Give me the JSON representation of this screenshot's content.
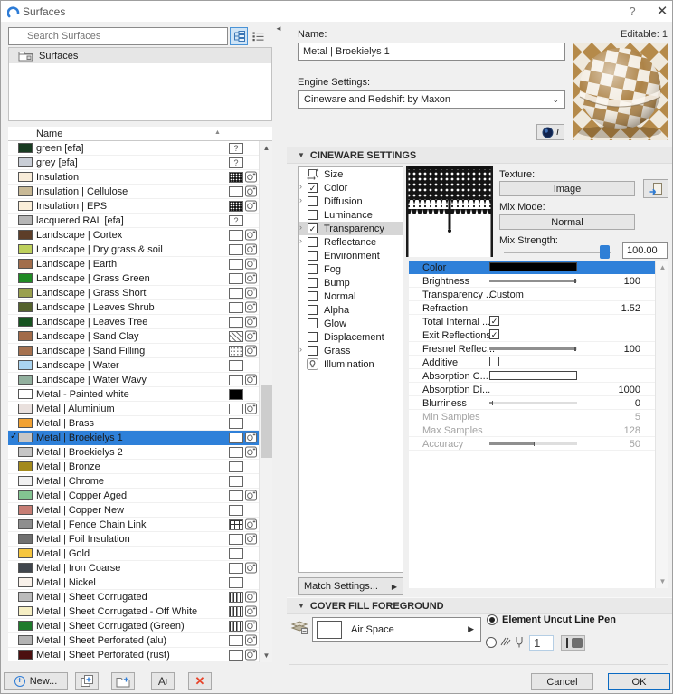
{
  "titlebar": {
    "title": "Surfaces",
    "help": "?",
    "close": "✕"
  },
  "left": {
    "search_placeholder": "Search Surfaces",
    "root_folder": "Surfaces",
    "list_header": "Name",
    "rows": [
      {
        "name": "green [efa]",
        "swatch": "#173a20",
        "fill": "question",
        "camera": false
      },
      {
        "name": "grey [efa]",
        "swatch": "#c9ced6",
        "fill": "question",
        "camera": false
      },
      {
        "name": "Insulation",
        "swatch": "#f8ecd9",
        "fill": "hatch_dense",
        "camera": true
      },
      {
        "name": "Insulation | Cellulose",
        "swatch": "#c8b996",
        "fill": "plain",
        "camera": true
      },
      {
        "name": "Insulation | EPS",
        "swatch": "#faeed9",
        "fill": "hatch_dense",
        "camera": true
      },
      {
        "name": "lacquered RAL [efa]",
        "swatch": "#b5b5b5",
        "fill": "question",
        "camera": false
      },
      {
        "name": "Landscape | Cortex",
        "swatch": "#5d3e29",
        "fill": "plain",
        "camera": true
      },
      {
        "name": "Landscape | Dry grass & soil",
        "swatch": "#bdd05c",
        "fill": "plain",
        "camera": true
      },
      {
        "name": "Landscape | Earth",
        "swatch": "#a26e4c",
        "fill": "plain",
        "camera": true
      },
      {
        "name": "Landscape | Grass Green",
        "swatch": "#1f8a24",
        "fill": "plain",
        "camera": true
      },
      {
        "name": "Landscape | Grass Short",
        "swatch": "#9aa04e",
        "fill": "plain",
        "camera": true
      },
      {
        "name": "Landscape | Leaves Shrub",
        "swatch": "#55632e",
        "fill": "plain",
        "camera": true
      },
      {
        "name": "Landscape | Leaves Tree",
        "swatch": "#175320",
        "fill": "plain",
        "camera": true
      },
      {
        "name": "Landscape | Sand Clay",
        "swatch": "#a26b49",
        "fill": "hatch_diag",
        "camera": true
      },
      {
        "name": "Landscape | Sand Filling",
        "swatch": "#a5714f",
        "fill": "dots",
        "camera": true
      },
      {
        "name": "Landscape | Water",
        "swatch": "#aad4f0",
        "fill": "plain",
        "camera": false
      },
      {
        "name": "Landscape | Water Wavy",
        "swatch": "#92b09e",
        "fill": "plain",
        "camera": true
      },
      {
        "name": "Metal - Painted white",
        "swatch": "#ffffff",
        "fill": "black",
        "camera": false
      },
      {
        "name": "Metal | Aluminium",
        "swatch": "#e9e0dd",
        "fill": "plain",
        "camera": true
      },
      {
        "name": "Metal | Brass",
        "swatch": "#f2a233",
        "fill": "plain",
        "camera": false
      },
      {
        "name": "Metal | Broekielys 1",
        "swatch": "#c6c6c6",
        "fill": "plain",
        "camera": true,
        "selected": true
      },
      {
        "name": "Metal | Broekielys 2",
        "swatch": "#c6c6c6",
        "fill": "plain",
        "camera": true
      },
      {
        "name": "Metal | Bronze",
        "swatch": "#a38a1c",
        "fill": "plain",
        "camera": false
      },
      {
        "name": "Metal | Chrome",
        "swatch": "#f0f0f0",
        "fill": "plain",
        "camera": false
      },
      {
        "name": "Metal | Copper Aged",
        "swatch": "#83c491",
        "fill": "plain",
        "camera": true
      },
      {
        "name": "Metal | Copper New",
        "swatch": "#c67d74",
        "fill": "plain",
        "camera": false
      },
      {
        "name": "Metal | Fence Chain Link",
        "swatch": "#8e8e8e",
        "fill": "grid",
        "camera": true
      },
      {
        "name": "Metal | Foil Insulation",
        "swatch": "#707070",
        "fill": "plain",
        "camera": true
      },
      {
        "name": "Metal | Gold",
        "swatch": "#f6c63f",
        "fill": "plain",
        "camera": false
      },
      {
        "name": "Metal | Iron Coarse",
        "swatch": "#40464d",
        "fill": "plain",
        "camera": true
      },
      {
        "name": "Metal | Nickel",
        "swatch": "#f8f1ea",
        "fill": "plain",
        "camera": false
      },
      {
        "name": "Metal | Sheet Corrugated",
        "swatch": "#bcbcbc",
        "fill": "vlines",
        "camera": true
      },
      {
        "name": "Metal | Sheet Corrugated - Off White",
        "swatch": "#f6efc4",
        "fill": "vlines",
        "camera": true
      },
      {
        "name": "Metal | Sheet Corrugated (Green)",
        "swatch": "#1e7b2c",
        "fill": "vlines",
        "camera": true
      },
      {
        "name": "Metal | Sheet Perforated (alu)",
        "swatch": "#b3b3b3",
        "fill": "plain",
        "camera": true
      },
      {
        "name": "Metal | Sheet Perforated (rust)",
        "swatch": "#4c1010",
        "fill": "plain",
        "camera": true
      }
    ]
  },
  "right": {
    "name_label": "Name:",
    "editable": "Editable: 1",
    "name_value": "Metal | Broekielys 1",
    "engine_label": "Engine Settings:",
    "engine_value": "Cineware and Redshift by Maxon",
    "c4d_info": "i"
  },
  "cineware": {
    "header": "CINEWARE SETTINGS",
    "channels": [
      {
        "label": "Size",
        "icon": "size"
      },
      {
        "label": "Color",
        "expand": true,
        "check": true,
        "checked": true
      },
      {
        "label": "Diffusion",
        "expand": true,
        "check": true,
        "checked": false
      },
      {
        "label": "Luminance",
        "check": true,
        "checked": false
      },
      {
        "label": "Transparency",
        "expand": true,
        "check": true,
        "checked": true,
        "selected": true
      },
      {
        "label": "Reflectance",
        "expand": true,
        "check": true,
        "checked": false
      },
      {
        "label": "Environment",
        "check": true,
        "checked": false
      },
      {
        "label": "Fog",
        "check": true,
        "checked": false
      },
      {
        "label": "Bump",
        "check": true,
        "checked": false
      },
      {
        "label": "Normal",
        "check": true,
        "checked": false
      },
      {
        "label": "Alpha",
        "check": true,
        "checked": false
      },
      {
        "label": "Glow",
        "check": true,
        "checked": false
      },
      {
        "label": "Displacement",
        "check": true,
        "checked": false
      },
      {
        "label": "Grass",
        "expand": true,
        "check": true,
        "checked": false
      },
      {
        "label": "Illumination",
        "icon": "lamp"
      }
    ],
    "texture_label": "Texture:",
    "texture_button": "Image",
    "mix_mode_label": "Mix Mode:",
    "mix_mode_button": "Normal",
    "mix_strength_label": "Mix Strength:",
    "mix_strength_value": "100.00",
    "params": [
      {
        "label": "Color",
        "type": "color",
        "color": "#000000",
        "selected": true
      },
      {
        "label": "Brightness",
        "type": "slider",
        "pct": 97,
        "value": "100"
      },
      {
        "label": "Transparency ...",
        "type": "text",
        "value": "Custom"
      },
      {
        "label": "Refraction",
        "type": "value",
        "value": "1.52"
      },
      {
        "label": "Total Internal ...",
        "type": "check",
        "checked": true
      },
      {
        "label": "Exit Reflections",
        "type": "check",
        "checked": true
      },
      {
        "label": "Fresnel Reflec...",
        "type": "slider",
        "pct": 97,
        "value": "100"
      },
      {
        "label": "Additive",
        "type": "check",
        "checked": false
      },
      {
        "label": "Absorption C...",
        "type": "color",
        "color": "#ffffff"
      },
      {
        "label": "Absorption Di...",
        "type": "value",
        "value": "1000"
      },
      {
        "label": "Blurriness",
        "type": "slider",
        "pct": 3,
        "value": "0"
      },
      {
        "label": "Min Samples",
        "type": "value",
        "value": "5",
        "disabled": true
      },
      {
        "label": "Max Samples",
        "type": "value",
        "value": "128",
        "disabled": true
      },
      {
        "label": "Accuracy",
        "type": "slider",
        "pct": 50,
        "value": "50",
        "disabled": true
      }
    ],
    "match_button": "Match Settings..."
  },
  "cover_fill": {
    "header": "COVER FILL FOREGROUND",
    "fill_name": "Air Space",
    "radio_uncut": "Element Uncut Line Pen",
    "pen_number": "1"
  },
  "footer": {
    "new_button": "New...",
    "cancel": "Cancel",
    "ok": "OK"
  }
}
